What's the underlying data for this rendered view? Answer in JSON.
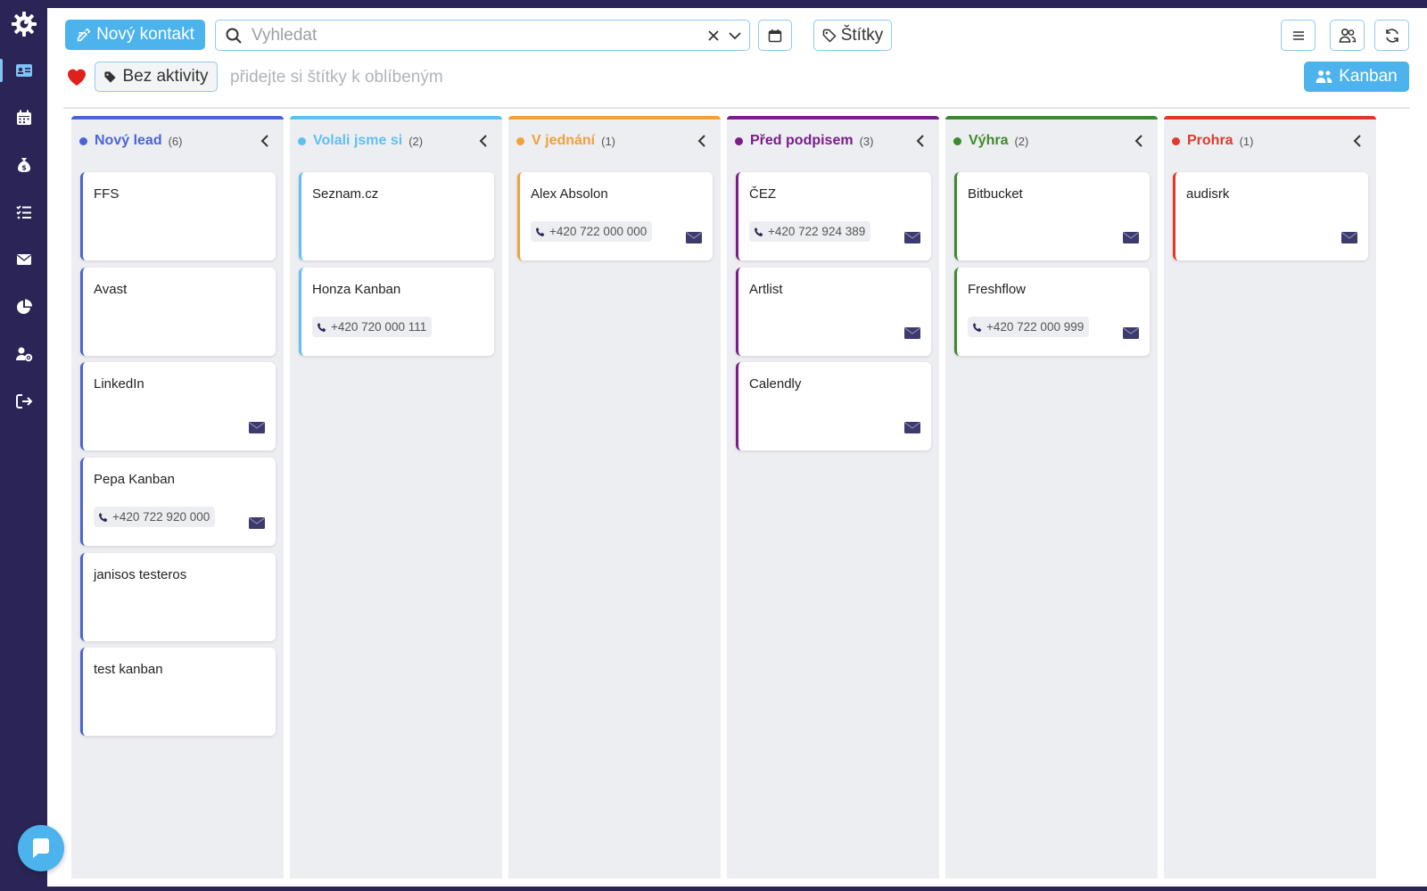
{
  "toolbar": {
    "new_contact_label": "Nový kontakt",
    "search_placeholder": "Vyhledat",
    "tags_label": "Štítky",
    "no_activity_label": "Bez aktivity",
    "favorites_hint": "přidejte si štítky k oblíbeným",
    "kanban_label": "Kanban"
  },
  "sidebar": {
    "items": [
      {
        "icon": "contacts-card-icon",
        "active": true
      },
      {
        "icon": "calendar-icon",
        "active": false
      },
      {
        "icon": "money-bag-icon",
        "active": false
      },
      {
        "icon": "task-list-icon",
        "active": false
      },
      {
        "icon": "envelope-icon",
        "active": false
      },
      {
        "icon": "pie-chart-icon",
        "active": false
      },
      {
        "icon": "user-settings-icon",
        "active": false
      },
      {
        "icon": "logout-icon",
        "active": false
      }
    ]
  },
  "colors": {
    "accent": "#4cb3ec",
    "sidebar_bg": "#2b2557"
  },
  "columns": [
    {
      "title": "Nový lead",
      "count": "(6)",
      "color": "#4a64d8",
      "cards": [
        {
          "name": "FFS",
          "phone": "",
          "mail": false
        },
        {
          "name": "Avast",
          "phone": "",
          "mail": false
        },
        {
          "name": "LinkedIn",
          "phone": "",
          "mail": true
        },
        {
          "name": "Pepa Kanban",
          "phone": "+420 722 920 000",
          "mail": true
        },
        {
          "name": "janisos testeros",
          "phone": "",
          "mail": false
        },
        {
          "name": "test kanban",
          "phone": "",
          "mail": false
        }
      ]
    },
    {
      "title": "Volali jsme si",
      "count": "(2)",
      "color": "#5ec0f0",
      "cards": [
        {
          "name": "Seznam.cz",
          "phone": "",
          "mail": false
        },
        {
          "name": "Honza Kanban",
          "phone": "+420 720 000 111",
          "mail": false
        }
      ]
    },
    {
      "title": "V jednání",
      "count": "(1)",
      "color": "#f0a13c",
      "cards": [
        {
          "name": "Alex Absolon",
          "phone": "+420 722 000 000",
          "mail": true
        }
      ]
    },
    {
      "title": "Před podpisem",
      "count": "(3)",
      "color": "#7a1d8a",
      "cards": [
        {
          "name": "ČEZ",
          "phone": "+420 722 924 389",
          "mail": true
        },
        {
          "name": "Artlist",
          "phone": "",
          "mail": true
        },
        {
          "name": "Calendly",
          "phone": "",
          "mail": true
        }
      ]
    },
    {
      "title": "Výhra",
      "count": "(2)",
      "color": "#3c8a2e",
      "cards": [
        {
          "name": "Bitbucket",
          "phone": "",
          "mail": true
        },
        {
          "name": "Freshflow",
          "phone": "+420 722 000 999",
          "mail": true
        }
      ]
    },
    {
      "title": "Prohra",
      "count": "(1)",
      "color": "#e0392b",
      "cards": [
        {
          "name": "audisrk",
          "phone": "",
          "mail": true
        }
      ]
    }
  ]
}
